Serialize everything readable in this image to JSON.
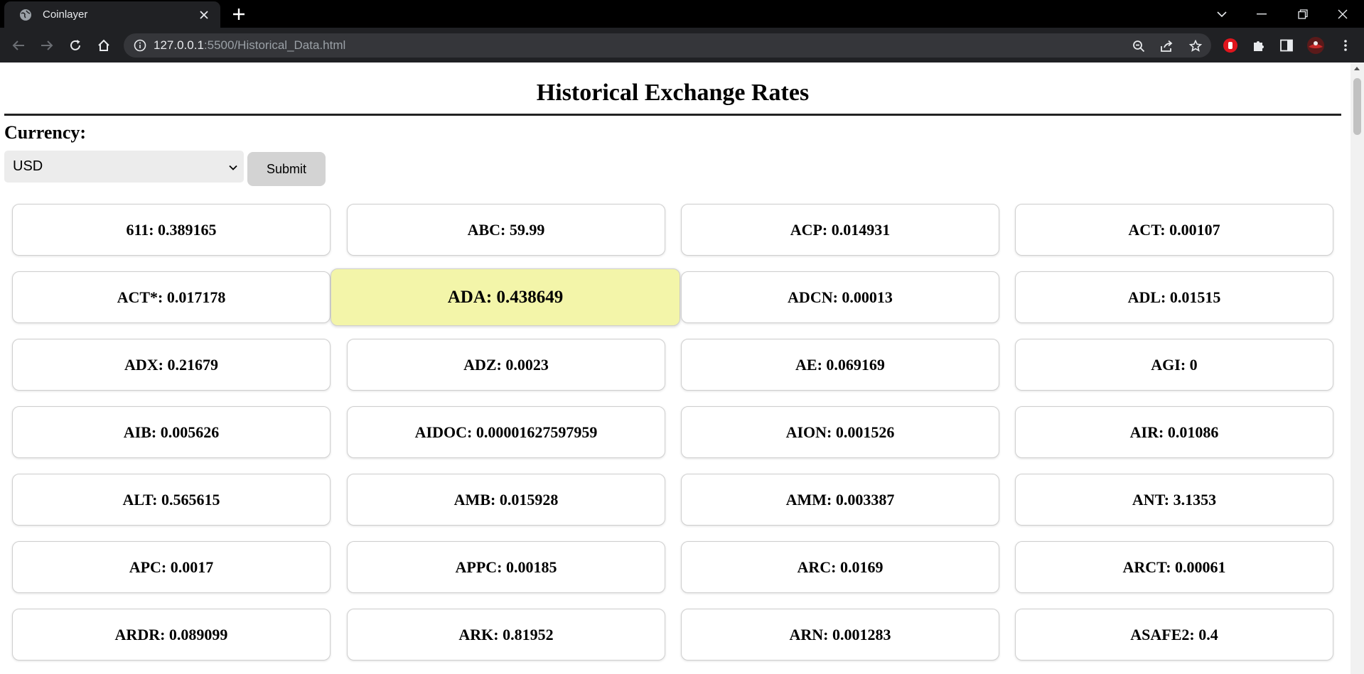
{
  "browser": {
    "tab_title": "Coinlayer",
    "url_host": "127.0.0.1",
    "url_path": ":5500/Historical_Data.html"
  },
  "page": {
    "title": "Historical Exchange Rates",
    "currency_label": "Currency:",
    "currency_selected": "USD",
    "submit_label": "Submit"
  },
  "rates": [
    {
      "label": "611: 0.389165"
    },
    {
      "label": "ABC: 59.99"
    },
    {
      "label": "ACP: 0.014931"
    },
    {
      "label": "ACT: 0.00107"
    },
    {
      "label": "ACT*: 0.017178"
    },
    {
      "label": "ADA: 0.438649",
      "hovered": true
    },
    {
      "label": "ADCN: 0.00013"
    },
    {
      "label": "ADL: 0.01515"
    },
    {
      "label": "ADX: 0.21679"
    },
    {
      "label": "ADZ: 0.0023"
    },
    {
      "label": "AE: 0.069169"
    },
    {
      "label": "AGI: 0"
    },
    {
      "label": "AIB: 0.005626"
    },
    {
      "label": "AIDOC: 0.00001627597959"
    },
    {
      "label": "AION: 0.001526"
    },
    {
      "label": "AIR: 0.01086"
    },
    {
      "label": "ALT: 0.565615"
    },
    {
      "label": "AMB: 0.015928"
    },
    {
      "label": "AMM: 0.003387"
    },
    {
      "label": "ANT: 3.1353"
    },
    {
      "label": "APC: 0.0017"
    },
    {
      "label": "APPC: 0.00185"
    },
    {
      "label": "ARC: 0.0169"
    },
    {
      "label": "ARCT: 0.00061"
    },
    {
      "label": "ARDR: 0.089099"
    },
    {
      "label": "ARK: 0.81952"
    },
    {
      "label": "ARN: 0.001283"
    },
    {
      "label": "ASAFE2: 0.4"
    }
  ],
  "colors": {
    "hover_card": "#f3f5a9",
    "chrome_bg": "#202124"
  }
}
